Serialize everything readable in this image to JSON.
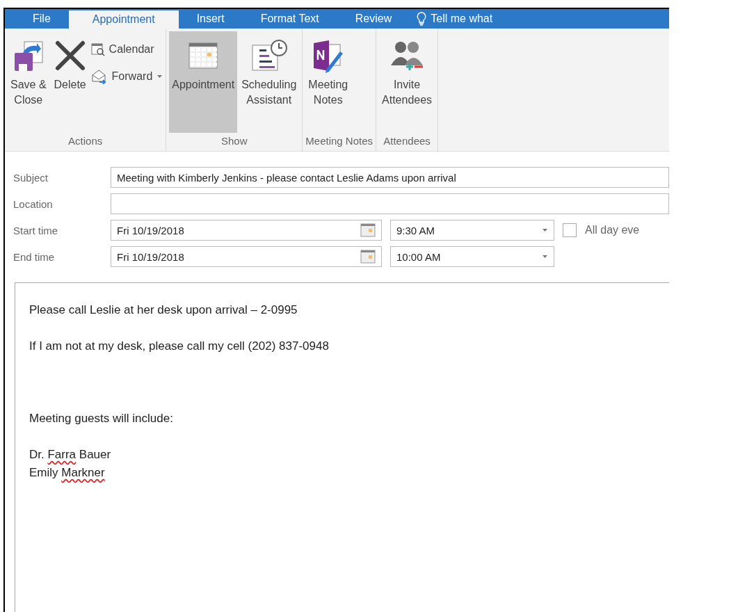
{
  "tabs": [
    {
      "label": "File",
      "selected": false
    },
    {
      "label": "Appointment",
      "selected": true
    },
    {
      "label": "Insert",
      "selected": false
    },
    {
      "label": "Format Text",
      "selected": false
    },
    {
      "label": "Review",
      "selected": false
    }
  ],
  "tell_me": {
    "placeholder": "Tell me what"
  },
  "ribbon": {
    "groups": [
      {
        "label": "Actions",
        "buttons": [
          {
            "kind": "large",
            "lines": [
              "Save &",
              "Close"
            ],
            "selected": false
          },
          {
            "kind": "large",
            "lines": [
              "Delete"
            ],
            "selected": false
          },
          {
            "kind": "stack",
            "items": [
              {
                "label": "Calendar",
                "dropdown": false
              },
              {
                "label": "Forward",
                "dropdown": true
              }
            ]
          }
        ]
      },
      {
        "label": "Show",
        "buttons": [
          {
            "kind": "large",
            "lines": [
              "Appointment"
            ],
            "selected": true
          },
          {
            "kind": "large",
            "lines": [
              "Scheduling",
              "Assistant"
            ],
            "selected": false
          }
        ]
      },
      {
        "label": "Meeting Notes",
        "buttons": [
          {
            "kind": "large",
            "lines": [
              "Meeting",
              "Notes"
            ],
            "selected": false
          }
        ]
      },
      {
        "label": "Attendees",
        "buttons": [
          {
            "kind": "large",
            "lines": [
              "Invite",
              "Attendees"
            ],
            "selected": false
          }
        ]
      }
    ]
  },
  "form": {
    "subject": {
      "label": "Subject",
      "value": "Meeting with Kimberly Jenkins - please contact Leslie Adams upon arrival"
    },
    "location": {
      "label": "Location"
    },
    "start": {
      "label": "Start time",
      "date": "Fri 10/19/2018",
      "time": "9:30 AM"
    },
    "end": {
      "label": "End time",
      "date": "Fri 10/19/2018",
      "time": "10:00 AM"
    },
    "all_day": {
      "label": "All day eve",
      "checked": false
    }
  },
  "body": [
    {
      "kind": "line",
      "segments": [
        {
          "text": "Please call Leslie at her desk upon arrival – 2-0995",
          "misspelled": false
        }
      ]
    },
    {
      "kind": "gap"
    },
    {
      "kind": "line",
      "segments": [
        {
          "text": "If I am not at my desk, please call my cell (202) 837-0948",
          "misspelled": false
        }
      ]
    },
    {
      "kind": "gap"
    },
    {
      "kind": "gap"
    },
    {
      "kind": "gap"
    },
    {
      "kind": "line",
      "segments": [
        {
          "text": "Meeting guests will include:",
          "misspelled": false
        }
      ]
    },
    {
      "kind": "gap"
    },
    {
      "kind": "line",
      "segments": [
        {
          "text": "Dr. ",
          "misspelled": false
        },
        {
          "text": "Farra",
          "misspelled": true
        },
        {
          "text": " Bauer",
          "misspelled": false
        }
      ]
    },
    {
      "kind": "line",
      "segments": [
        {
          "text": "Emily ",
          "misspelled": false
        },
        {
          "text": "Markner",
          "misspelled": true
        }
      ]
    }
  ]
}
